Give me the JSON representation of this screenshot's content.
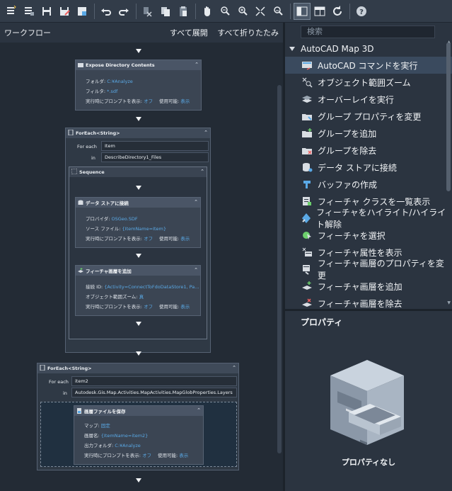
{
  "workflow": {
    "title": "ワークフロー",
    "expand_all": "すべて展開",
    "collapse_all": "すべて折りたたみ",
    "activities": {
      "expose": {
        "title": "Expose Directory Contents",
        "folder_label": "フォルダ:",
        "folder_value": "C:¥Analyze",
        "filter_label": "フィルタ:",
        "filter_value": "*.sdf",
        "prompt_label": "実行時にプロンプトを表示:",
        "prompt_value": "オフ",
        "enabled_label": "使用可能:",
        "enabled_value": "表示"
      },
      "foreach1": {
        "title": "ForEach<String>",
        "for_each_label": "For each",
        "for_each_value": "Item",
        "in_label": "in",
        "in_value": "DescribeDirectory1_Files",
        "sequence_title": "Sequence",
        "datastore": {
          "title": "データ ストアに接続",
          "provider_label": "プロバイダ:",
          "provider_value": "OSGeo.SDF",
          "source_label": "ソース ファイル:",
          "source_value": "{ItemName=Item}",
          "prompt_label": "実行時にプロンプトを表示:",
          "prompt_value": "オフ",
          "enabled_label": "使用可能:",
          "enabled_value": "表示"
        },
        "addlayer": {
          "title": "フィーチャ画層を追加",
          "conn_label": "接続 ID:",
          "conn_value": "{Activity=ConnectToFdoDataStore1, Pa...",
          "zoom_label": "オブジェクト範囲ズーム:",
          "zoom_value": "真",
          "prompt_label": "実行時にプロンプトを表示:",
          "prompt_value": "オフ",
          "enabled_label": "使用可能:",
          "enabled_value": "表示"
        }
      },
      "foreach2": {
        "title": "ForEach<String>",
        "for_each_label": "For each",
        "for_each_value": "item2",
        "in_label": "in",
        "in_value": "Autodesk.Gis.Map.Activities.MapActivities.MapGlobProperties.Layers",
        "savelayer": {
          "title": "画層ファイルを保存",
          "map_label": "マップ:",
          "map_value": "固定",
          "layer_label": "画層名:",
          "layer_value": "{ItemName=item2}",
          "outfolder_label": "出力フォルダ:",
          "outfolder_value": "C:¥Analyze",
          "prompt_label": "実行時にプロンプトを表示:",
          "prompt_value": "オフ",
          "enabled_label": "使用可能:",
          "enabled_value": "表示"
        }
      }
    }
  },
  "toolbox": {
    "search_placeholder": "検索",
    "group": "AutoCAD Map 3D",
    "commands": [
      {
        "label": "AutoCAD コマンドを実行",
        "icon": "run-command-icon"
      },
      {
        "label": "オブジェクト範囲ズーム",
        "icon": "zoom-extents-icon"
      },
      {
        "label": "オーバーレイを実行",
        "icon": "overlay-icon"
      },
      {
        "label": "グループ プロパティを変更",
        "icon": "group-properties-icon"
      },
      {
        "label": "グループを追加",
        "icon": "add-group-icon"
      },
      {
        "label": "グループを除去",
        "icon": "remove-group-icon"
      },
      {
        "label": "データ ストアに接続",
        "icon": "datastore-icon"
      },
      {
        "label": "バッファの作成",
        "icon": "buffer-icon"
      },
      {
        "label": "フィーチャ クラスを一覧表示",
        "icon": "list-feature-class-icon"
      },
      {
        "label": "フィーチャをハイライト/ハイライト解除",
        "icon": "highlight-icon"
      },
      {
        "label": "フィーチャを選択",
        "icon": "select-feature-icon"
      },
      {
        "label": "フィーチャ属性を表示",
        "icon": "feature-attributes-icon"
      },
      {
        "label": "フィーチャ画層のプロパティを変更",
        "icon": "layer-properties-icon"
      },
      {
        "label": "フィーチャ画層を追加",
        "icon": "add-layer-icon"
      },
      {
        "label": "フィーチャ画層を除去",
        "icon": "remove-layer-icon"
      }
    ]
  },
  "properties": {
    "title": "プロパティ",
    "empty": "プロパティなし"
  },
  "colors": {
    "accent": "#5aa9e6",
    "background": "#2b3440"
  }
}
